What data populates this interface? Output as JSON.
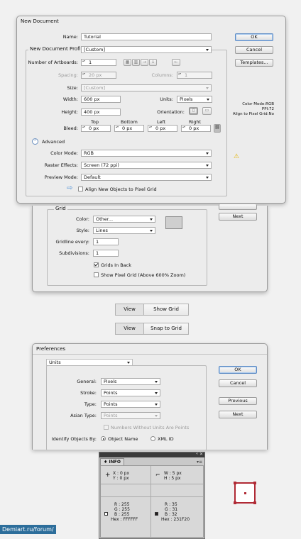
{
  "new_document": {
    "title": "New Document",
    "name_label": "Name:",
    "name_value": "Tutorial",
    "profile_label": "New Document Profile:",
    "profile_value": "[Custom]",
    "artboards_label": "Number of Artboards:",
    "artboards_value": "1",
    "spacing_label": "Spacing:",
    "spacing_value": "20 px",
    "columns_label": "Columns:",
    "columns_value": "1",
    "size_label": "Size:",
    "size_value": "[Custom]",
    "width_label": "Width:",
    "width_value": "600 px",
    "units_label": "Units:",
    "units_value": "Pixels",
    "height_label": "Height:",
    "height_value": "400 px",
    "orientation_label": "Orientation:",
    "bleed_label": "Bleed:",
    "bleed_headers": [
      "Top",
      "Bottom",
      "Left",
      "Right"
    ],
    "bleed_values": [
      "0 px",
      "0 px",
      "0 px",
      "0 px"
    ],
    "advanced_label": "Advanced",
    "color_mode_label": "Color Mode:",
    "color_mode_value": "RGB",
    "raster_label": "Raster Effects:",
    "raster_value": "Screen (72 ppi)",
    "preview_label": "Preview Mode:",
    "preview_value": "Default",
    "align_label": "Align New Objects to Pixel Grid",
    "ok": "OK",
    "cancel": "Cancel",
    "templates": "Templates...",
    "info_line1": "Color Mode:RGB",
    "info_line2": "PPI:72",
    "info_line3": "Align to Pixel Grid:No"
  },
  "grid_prefs": {
    "group_label": "Grid",
    "next": "Next",
    "color_label": "Color:",
    "color_value": "Other...",
    "style_label": "Style:",
    "style_value": "Lines",
    "gridline_label": "Gridline every:",
    "gridline_value": "1",
    "subdiv_label": "Subdivisions:",
    "subdiv_value": "1",
    "grids_back": "Grids In Back",
    "pixel_grid": "Show Pixel Grid (Above 600% Zoom)"
  },
  "toolbar1": {
    "view": "View",
    "action": "Show Grid"
  },
  "toolbar2": {
    "view": "View",
    "action": "Snap to Grid"
  },
  "preferences": {
    "title": "Preferences",
    "section": "Units",
    "general_label": "General:",
    "general_value": "Pixels",
    "stroke_label": "Stroke:",
    "stroke_value": "Points",
    "type_label": "Type:",
    "type_value": "Points",
    "asian_label": "Asian Type:",
    "asian_value": "Points",
    "numbers_label": "Numbers Without Units Are Points",
    "identify_label": "Identify Objects By:",
    "object_name": "Object Name",
    "xml_id": "XML ID",
    "ok": "OK",
    "cancel": "Cancel",
    "previous": "Previous",
    "next": "Next"
  },
  "info_panel": {
    "tab": "♦ INFO",
    "x": "X : 0 px",
    "y": "Y : 0 px",
    "w": "W : 5 px",
    "h": "H : 5 px",
    "r1": "R : 255",
    "g1": "G : 255",
    "b1": "B : 255",
    "hex1": "Hex : FFFFFF",
    "r2": "R : 35",
    "g2": "G : 31",
    "b2": "B : 32",
    "hex2": "Hex : 231F20"
  },
  "watermark": "Demiart.ru/forum/",
  "colors": {
    "accent": "#5d8bc4",
    "pixel_red": "#b02a35",
    "watermark_bg": "#2d6e9b"
  }
}
